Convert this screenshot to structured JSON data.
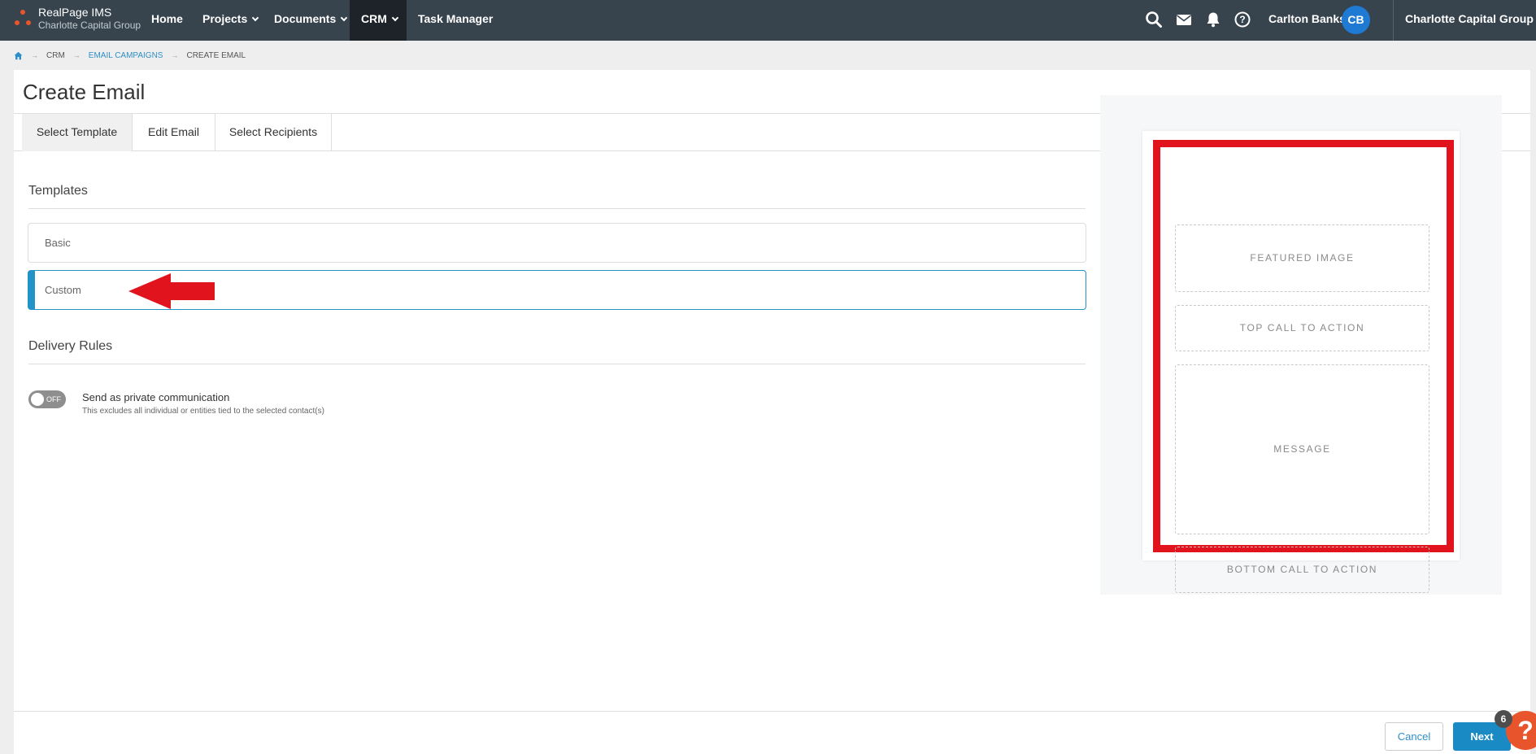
{
  "app": {
    "name": "RealPage IMS",
    "org": "Charlotte Capital Group"
  },
  "nav": {
    "items": [
      {
        "label": "Home"
      },
      {
        "label": "Projects"
      },
      {
        "label": "Documents"
      },
      {
        "label": "CRM"
      },
      {
        "label": "Task Manager"
      }
    ],
    "active": "CRM",
    "icons": [
      "search-icon",
      "mail-icon",
      "bell-icon",
      "help-icon"
    ]
  },
  "user": {
    "name": "Carlton Banks",
    "initials": "CB"
  },
  "org_selector": {
    "label": "Charlotte Capital Group"
  },
  "breadcrumb": {
    "items": [
      "CRM",
      "EMAIL CAMPAIGNS",
      "CREATE EMAIL"
    ]
  },
  "page": {
    "title": "Create Email"
  },
  "tabs": [
    {
      "label": "Select Template"
    },
    {
      "label": "Edit Email"
    },
    {
      "label": "Select Recipients"
    }
  ],
  "templates": {
    "heading": "Templates",
    "options": [
      {
        "label": "Basic"
      },
      {
        "label": "Custom"
      }
    ],
    "selected": "Custom"
  },
  "delivery": {
    "heading": "Delivery Rules",
    "toggle_state": "OFF",
    "label": "Send as private communication",
    "help": "This excludes all individual or entities tied to the selected contact(s)"
  },
  "preview": {
    "slots": [
      "FEATURED IMAGE",
      "TOP CALL TO ACTION",
      "MESSAGE",
      "BOTTOM CALL TO ACTION"
    ]
  },
  "footer": {
    "cancel_label": "Cancel",
    "next_label": "Next",
    "help_badge_count": "6",
    "help_fab_label": "?"
  },
  "colors": {
    "nav_bg": "#37434d",
    "accent": "#1a8ac4",
    "highlight_red": "#e1141e",
    "brand_orange": "#e8552c"
  }
}
